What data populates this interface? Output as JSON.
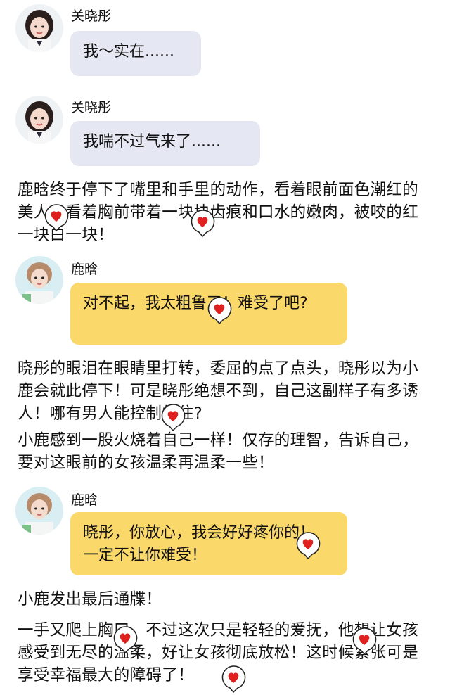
{
  "messages": [
    {
      "sender": "关晓彤",
      "text": "我～实在......",
      "avatar_icon": "avatar-guan"
    },
    {
      "sender": "关晓彤",
      "text": "我喘不过气来了......",
      "avatar_icon": "avatar-guan"
    },
    {
      "sender": "鹿晗",
      "text": "对不起，我太粗鲁了！难受了吧?",
      "avatar_icon": "avatar-lu"
    },
    {
      "sender": "鹿晗",
      "text": "晓彤，你放心，我会好好疼你的！一定不让你难受！",
      "avatar_icon": "avatar-lu"
    }
  ],
  "narration": [
    "鹿晗终于停下了嘴里和手里的动作，看着眼前面色潮红的美人，看着胸前带着一块块齿痕和口水的嫩肉，被咬的红一块白一块！",
    "晓彤的眼泪在眼睛里打转，委屈的点了点头，晓彤以为小鹿会就此停下！可是晓彤绝想不到，自己这副样子有多诱人！哪有男人能控制的住?",
    "小鹿感到一股火烧着自己一样！仅存的理智，告诉自己，要对这眼前的女孩温柔再温柔一些！",
    "小鹿发出最后通牒！",
    "一手又爬上胸口，不过这次只是轻轻的爱抚，他想让女孩感受到无尽的温柔，好让女孩彻底放松！这时候紧张可是享受幸福最大的障碍了！"
  ],
  "colors": {
    "gray_bubble": "#e5e8f2",
    "yellow_bubble": "#fbd86a",
    "heart": "#e0201e"
  },
  "overlay_icons": [
    "heart-sticker-icon"
  ]
}
